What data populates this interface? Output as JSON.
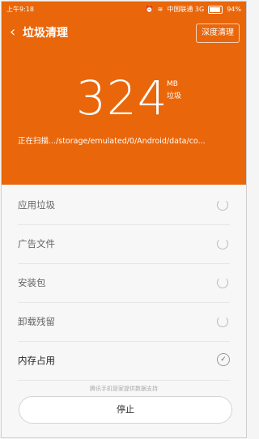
{
  "status_bar": {
    "time": "上午9:18",
    "carrier": "中国联通 3G",
    "battery": "94%",
    "icons": [
      "alarm-icon",
      "wifi-icon",
      "signal-icon",
      "battery-icon"
    ]
  },
  "header": {
    "title": "垃圾清理",
    "deep_clean_label": "深度清理"
  },
  "summary": {
    "size_value": "324",
    "size_unit": "MB",
    "size_caption": "垃圾",
    "scanning_text": "正在扫描.../storage/emulated/0/Android/data/co..."
  },
  "categories": [
    {
      "label": "应用垃圾",
      "state": "scanning"
    },
    {
      "label": "广告文件",
      "state": "scanning"
    },
    {
      "label": "安装包",
      "state": "scanning"
    },
    {
      "label": "卸载残留",
      "state": "scanning"
    },
    {
      "label": "内存占用",
      "state": "done"
    }
  ],
  "footer": {
    "support_text": "腾讯手机管家提供数据支持",
    "stop_label": "停止"
  },
  "colors": {
    "accent": "#e9660a",
    "background": "#f7f7f7"
  }
}
